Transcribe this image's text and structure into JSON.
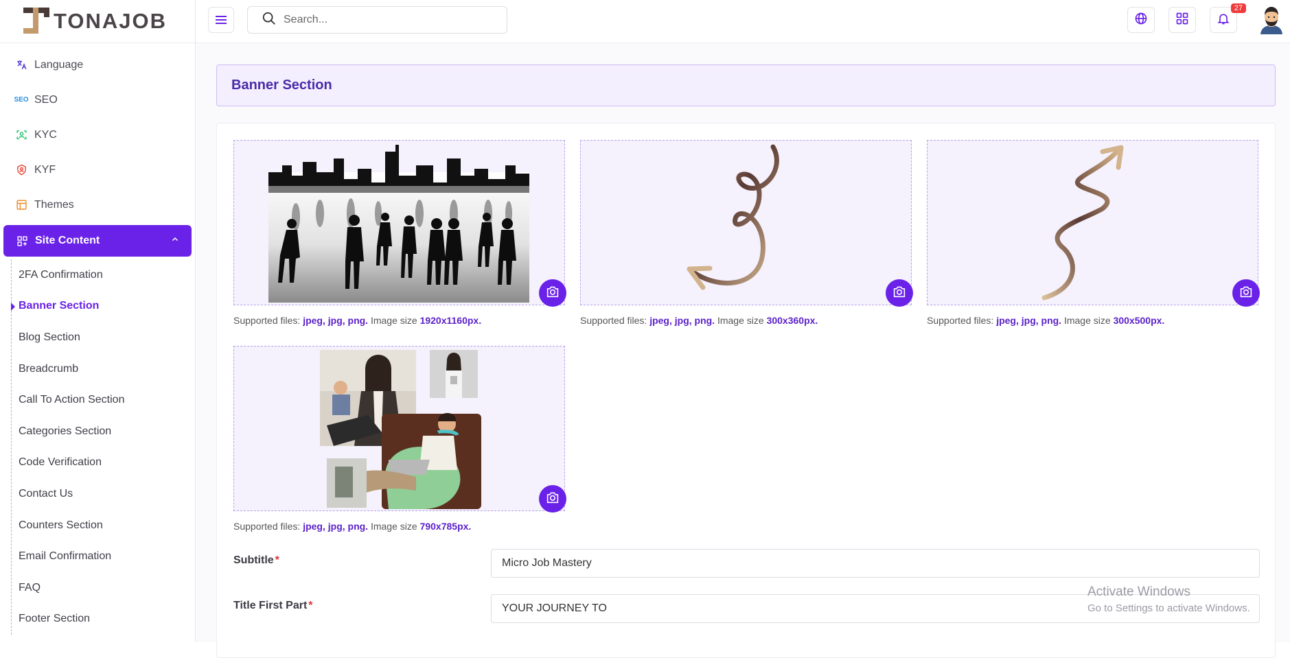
{
  "brand": {
    "name": "TONAJOB"
  },
  "sidebar": {
    "items": [
      {
        "label": "Language",
        "icon": "translate-icon"
      },
      {
        "label": "SEO",
        "icon": "seo-icon"
      },
      {
        "label": "KYC",
        "icon": "face-scan-icon"
      },
      {
        "label": "KYF",
        "icon": "shield-user-icon"
      },
      {
        "label": "Themes",
        "icon": "layout-icon"
      }
    ],
    "active": {
      "label": "Site Content",
      "icon": "grid-plus-icon"
    },
    "sub_items": [
      "2FA Confirmation",
      "Banner Section",
      "Blog Section",
      "Breadcrumb",
      "Call To Action Section",
      "Categories Section",
      "Code Verification",
      "Contact Us",
      "Counters Section",
      "Email Confirmation",
      "FAQ",
      "Footer Section"
    ],
    "current_sub": "Banner Section"
  },
  "header": {
    "search_placeholder": "Search...",
    "notification_count": "27"
  },
  "page": {
    "title": "Banner Section",
    "uploads": [
      {
        "name": "city-crowd-image",
        "supported_label": "Supported files:",
        "formats": "jpeg, jpg, png.",
        "size_label": "Image size",
        "size": "1920x1160px."
      },
      {
        "name": "curly-arrow-left-image",
        "supported_label": "Supported files:",
        "formats": "jpeg, jpg, png.",
        "size_label": "Image size",
        "size": "300x360px."
      },
      {
        "name": "curly-arrow-up-image",
        "supported_label": "Supported files:",
        "formats": "jpeg, jpg, png.",
        "size_label": "Image size",
        "size": "300x500px."
      },
      {
        "name": "people-collage-image",
        "supported_label": "Supported files:",
        "formats": "jpeg, jpg, png.",
        "size_label": "Image size",
        "size": "790x785px."
      }
    ],
    "fields": [
      {
        "label": "Subtitle",
        "required": "*",
        "value": "Micro Job Mastery"
      },
      {
        "label": "Title First Part",
        "required": "*",
        "value": "YOUR JOURNEY TO"
      }
    ]
  },
  "watermark": {
    "line1": "Activate Windows",
    "line2": "Go to Settings to activate Windows."
  },
  "colors": {
    "accent": "#6a21e8",
    "badge": "#ef3b3b"
  }
}
